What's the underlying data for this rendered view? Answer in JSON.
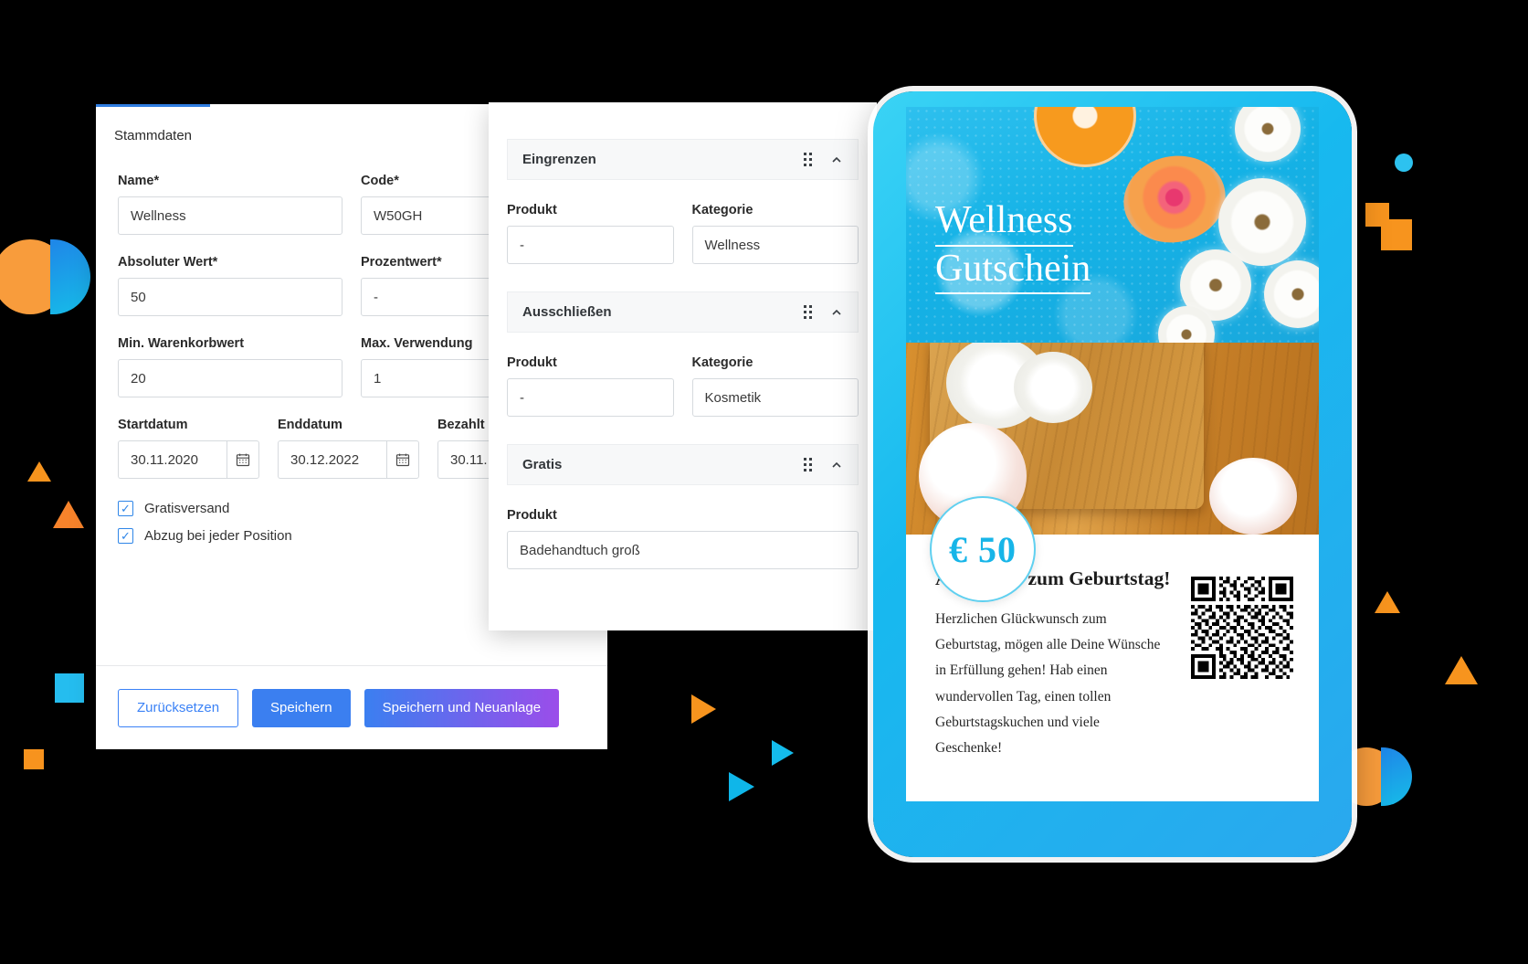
{
  "form": {
    "tab_label": "Stammdaten",
    "fields": [
      {
        "label": "Name*",
        "value": "Wellness"
      },
      {
        "label": "Code*",
        "value": "W50GH"
      },
      {
        "label": "Absoluter Wert*",
        "value": "50"
      },
      {
        "label": "Prozentwert*",
        "value": "-"
      },
      {
        "label": "Min. Warenkorbwert",
        "value": "20"
      },
      {
        "label": "Max. Verwendung",
        "value": "1"
      }
    ],
    "dates": [
      {
        "label": "Startdatum",
        "value": "30.11.2020",
        "icon": "calendar-icon"
      },
      {
        "label": "Enddatum",
        "value": "30.12.2022",
        "icon": "calendar-icon"
      },
      {
        "label": "Bezahlt",
        "value": "30.11.",
        "icon": "calendar-icon"
      }
    ],
    "checkboxes": [
      {
        "label": "Gratisversand",
        "checked": true,
        "mark": "✓"
      },
      {
        "label": "Abzug bei jeder Position",
        "checked": true,
        "mark": "✓"
      }
    ],
    "buttons": {
      "reset": "Zurücksetzen",
      "save": "Speichern",
      "save_new": "Speichern und Neuanlage"
    }
  },
  "panel": {
    "sections": [
      {
        "title": "Eingrenzen",
        "grip_icon": "drag-handle-icon",
        "chevron_icon": "chevron-up-icon",
        "fields": [
          {
            "label": "Produkt",
            "value": "-"
          },
          {
            "label": "Kategorie",
            "value": "Wellness"
          }
        ]
      },
      {
        "title": "Ausschließen",
        "grip_icon": "drag-handle-icon",
        "chevron_icon": "chevron-up-icon",
        "fields": [
          {
            "label": "Produkt",
            "value": "-"
          },
          {
            "label": "Kategorie",
            "value": "Kosmetik"
          }
        ]
      },
      {
        "title": "Gratis",
        "grip_icon": "drag-handle-icon",
        "chevron_icon": "chevron-up-icon",
        "fields": [
          {
            "label": "Produkt",
            "value": "Badehandtuch groß"
          }
        ]
      }
    ]
  },
  "voucher": {
    "title_line1": "Wellness",
    "title_line2": "Gutschein",
    "price": "€ 50",
    "heading": "Alles Gute zum Geburtstag!",
    "body": "Herzlichen Glückwunsch zum Geburtstag, mögen alle Deine Wünsche in Erfüllung gehen! Hab einen wundervollen Tag, einen tollen Geburtstagskuchen und viele Geschenke!",
    "qr_name": "qr-code"
  },
  "colors": {
    "accent_blue": "#3b7ff0",
    "accent_purple": "#9b4dea",
    "cyan": "#17b5e8",
    "orange": "#f7941e"
  }
}
